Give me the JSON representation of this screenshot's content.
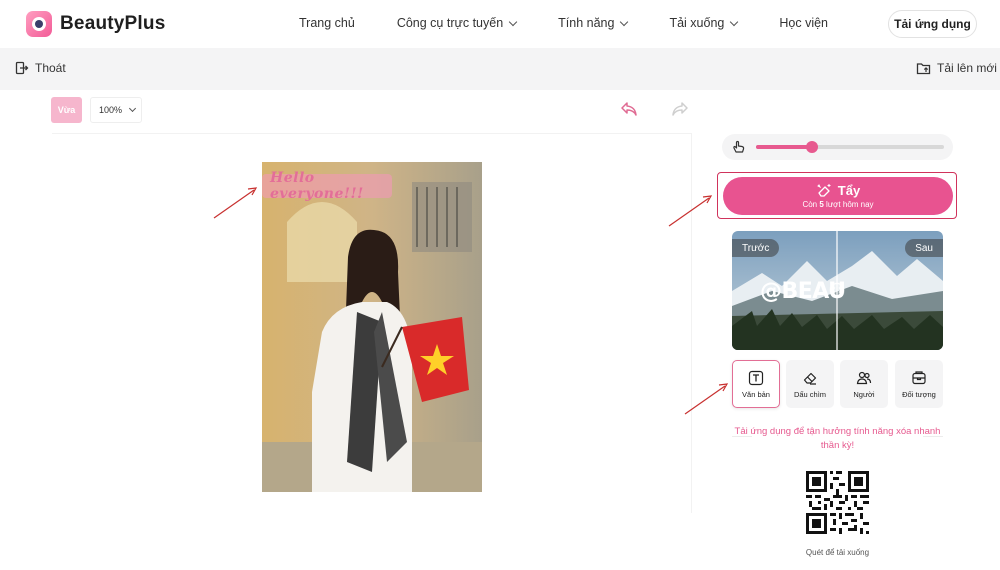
{
  "brand": {
    "name": "BeautyPlus",
    "accent": "#e85390"
  },
  "nav": {
    "items": [
      {
        "label": "Trang chủ",
        "dropdown": false
      },
      {
        "label": "Công cụ trực tuyến",
        "dropdown": true
      },
      {
        "label": "Tính năng",
        "dropdown": true
      },
      {
        "label": "Tải xuống",
        "dropdown": true
      },
      {
        "label": "Học viện",
        "dropdown": false
      }
    ],
    "cta": "Tải ứng dụng"
  },
  "subbar": {
    "exit_label": "Thoát",
    "upload_label": "Tải lên mới"
  },
  "toolbar": {
    "fit_label": "Vừa",
    "zoom_value": "100%"
  },
  "canvas": {
    "watermark_text": "Hello everyone!!!"
  },
  "panel": {
    "erase": {
      "label": "Tẩy",
      "sub_prefix": "Còn",
      "sub_count": "5",
      "sub_suffix": "lượt hôm nay"
    },
    "brush_size_fraction": 0.3,
    "compare": {
      "before_label": "Trước",
      "after_label": "Sau",
      "sample_text": "@BEAU"
    },
    "tools": [
      {
        "label": "Văn bản",
        "icon": "text-icon",
        "active": true
      },
      {
        "label": "Dấu chìm",
        "icon": "eraser-icon",
        "active": false
      },
      {
        "label": "Người",
        "icon": "people-icon",
        "active": false
      },
      {
        "label": "Đối tượng",
        "icon": "object-icon",
        "active": false
      }
    ],
    "promo": "Tải ứng dụng để tận hưởng tính năng xóa nhanh thần kỳ!",
    "qr_caption": "Quét để tải xuống"
  }
}
